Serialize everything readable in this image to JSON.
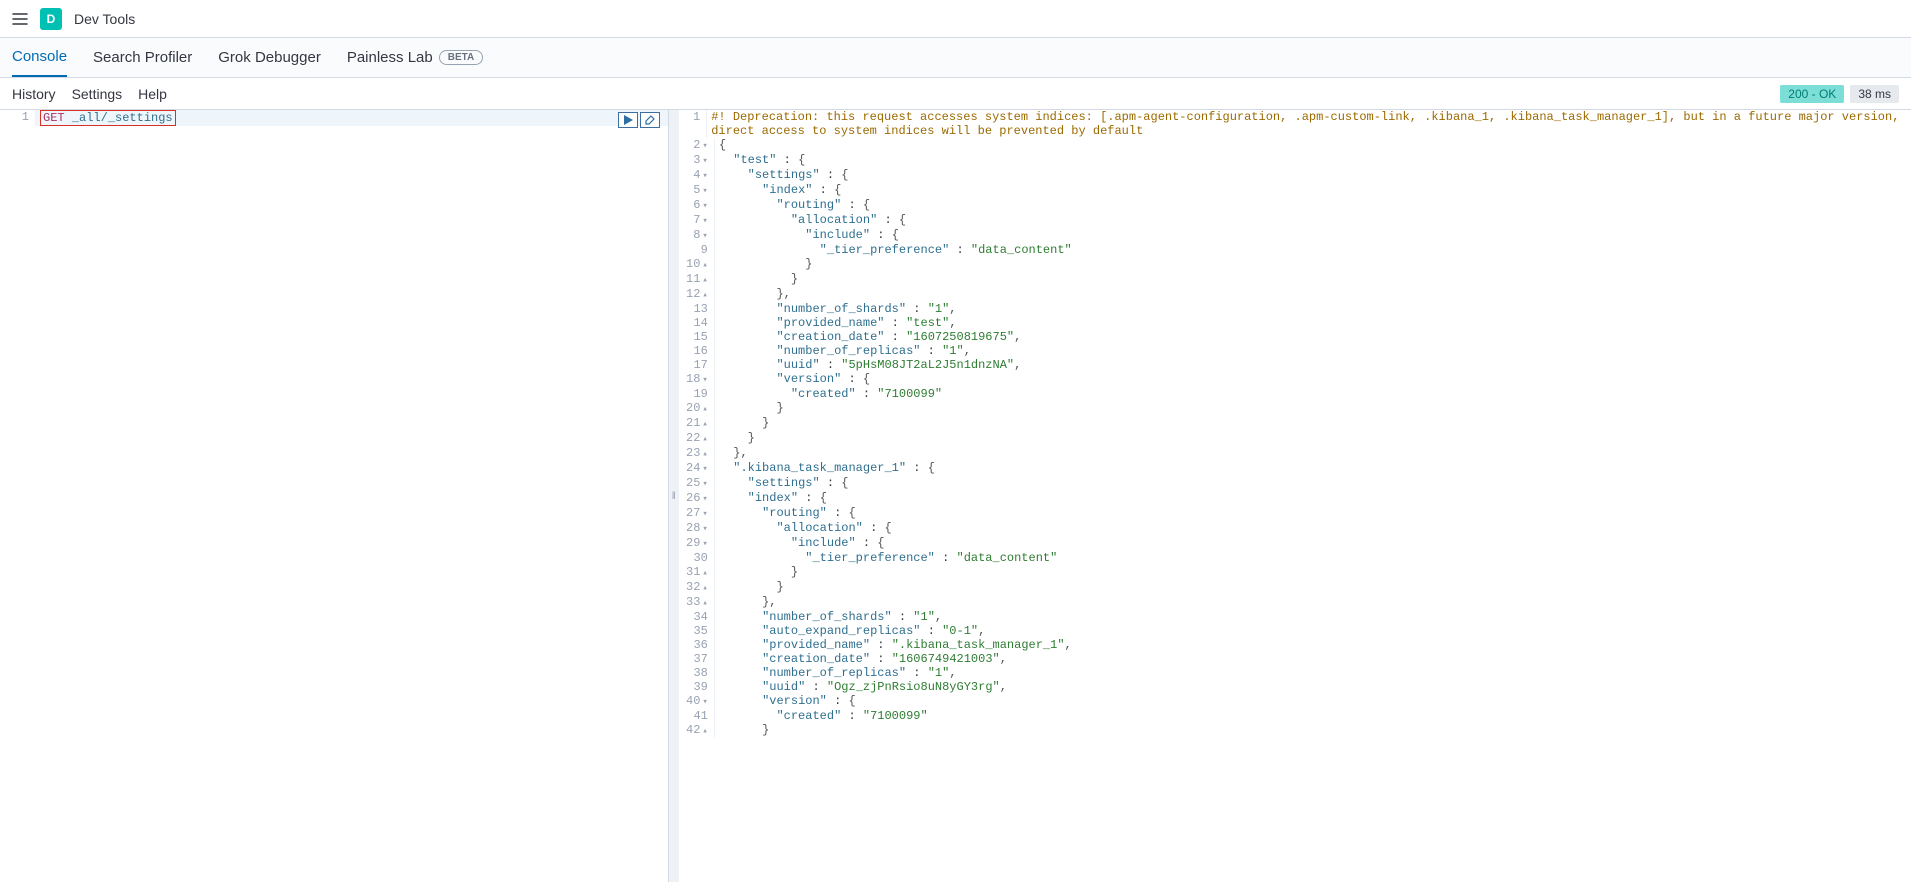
{
  "header": {
    "badge_letter": "D",
    "title": "Dev Tools"
  },
  "tabs": {
    "console": "Console",
    "profiler": "Search Profiler",
    "grok": "Grok Debugger",
    "painless": "Painless Lab",
    "beta": "BETA"
  },
  "subtoolbar": {
    "history": "History",
    "settings": "Settings",
    "help": "Help",
    "status": "200 - OK",
    "time": "38 ms"
  },
  "request": {
    "method": "GET",
    "path": "_all/_settings"
  },
  "response": {
    "deprecation": "#! Deprecation: this request accesses system indices: [.apm-agent-configuration, .apm-custom-link, .kibana_1, .kibana_task_manager_1], but in a future major version, direct access to system indices will be prevented by default",
    "body": {
      "test": {
        "settings": {
          "index": {
            "routing": {
              "allocation": {
                "include": {
                  "_tier_preference": "data_content"
                }
              }
            },
            "number_of_shards": "1",
            "provided_name": "test",
            "creation_date": "1607250819675",
            "number_of_replicas": "1",
            "uuid": "5pHsM08JT2aL2J5n1dnzNA",
            "version": {
              "created": "7100099"
            }
          }
        }
      },
      ".kibana_task_manager_1": {
        "settings": {
          "index": {
            "routing": {
              "allocation": {
                "include": {
                  "_tier_preference": "data_content"
                }
              }
            },
            "number_of_shards": "1",
            "auto_expand_replicas": "0-1",
            "provided_name": ".kibana_task_manager_1",
            "creation_date": "1606749421003",
            "number_of_replicas": "1",
            "uuid": "Ogz_zjPnRsio8uN8yGY3rg",
            "version": {
              "created": "7100099"
            }
          }
        }
      }
    }
  },
  "lines": {
    "l2": "{",
    "l3": "  \"test\" : {",
    "l4": "    \"settings\" : {",
    "l5": "      \"index\" : {",
    "l6": "        \"routing\" : {",
    "l7": "          \"allocation\" : {",
    "l8": "            \"include\" : {",
    "l9": "              \"_tier_preference\" : \"data_content\"",
    "l10": "            }",
    "l11": "          }",
    "l12": "        },",
    "l13": "        \"number_of_shards\" : \"1\",",
    "l14": "        \"provided_name\" : \"test\",",
    "l15": "        \"creation_date\" : \"1607250819675\",",
    "l16": "        \"number_of_replicas\" : \"1\",",
    "l17": "        \"uuid\" : \"5pHsM08JT2aL2J5n1dnzNA\",",
    "l18": "        \"version\" : {",
    "l19": "          \"created\" : \"7100099\"",
    "l20": "        }",
    "l21": "      }",
    "l22": "    }",
    "l23": "  },",
    "l24": "  \".kibana_task_manager_1\" : {",
    "l25": "    \"settings\" : {",
    "l26": "    \"index\" : {",
    "l27": "      \"routing\" : {",
    "l28": "        \"allocation\" : {",
    "l29": "          \"include\" : {",
    "l30": "            \"_tier_preference\" : \"data_content\"",
    "l31": "          }",
    "l32": "        }",
    "l33": "      },",
    "l34": "      \"number_of_shards\" : \"1\",",
    "l35": "      \"auto_expand_replicas\" : \"0-1\",",
    "l36": "      \"provided_name\" : \".kibana_task_manager_1\",",
    "l37": "      \"creation_date\" : \"1606749421003\",",
    "l38": "      \"number_of_replicas\" : \"1\",",
    "l39": "      \"uuid\" : \"Ogz_zjPnRsio8uN8yGY3rg\",",
    "l40": "      \"version\" : {",
    "l41": "        \"created\" : \"7100099\"",
    "l42": "      }"
  }
}
